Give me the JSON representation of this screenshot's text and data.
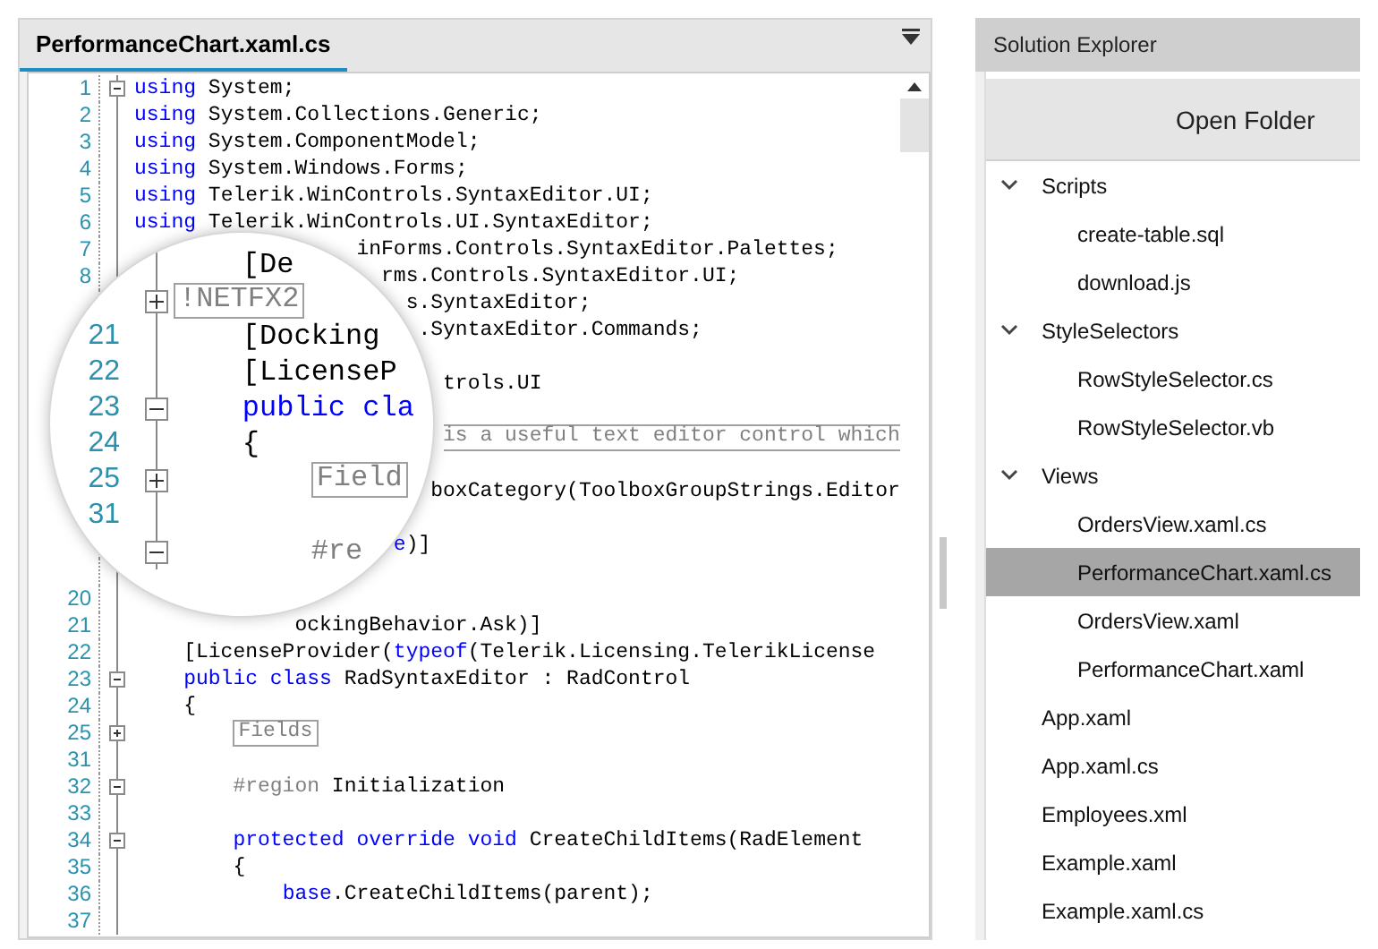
{
  "editor": {
    "tab": {
      "label": "PerformanceChart.xaml.cs",
      "selected": true
    },
    "rows": [
      {
        "number": "1",
        "expanded": true,
        "segments": [
          {
            "kind": "keyword",
            "text": "using"
          },
          {
            "kind": "plain",
            "text": " System;"
          }
        ]
      },
      {
        "number": "2",
        "segments": [
          {
            "kind": "keyword",
            "text": "using"
          },
          {
            "kind": "plain",
            "text": " System.Collections.Generic;"
          }
        ]
      },
      {
        "number": "3",
        "segments": [
          {
            "kind": "keyword",
            "text": "using"
          },
          {
            "kind": "plain",
            "text": " System.ComponentModel;"
          }
        ]
      },
      {
        "number": "4",
        "segments": [
          {
            "kind": "keyword",
            "text": "using"
          },
          {
            "kind": "plain",
            "text": " System.Windows.Forms;"
          }
        ]
      },
      {
        "number": "5",
        "segments": [
          {
            "kind": "keyword",
            "text": "using"
          },
          {
            "kind": "plain",
            "text": " Telerik.WinControls.SyntaxEditor.UI;"
          }
        ]
      },
      {
        "number": "6",
        "segments": [
          {
            "kind": "keyword",
            "text": "using"
          },
          {
            "kind": "plain",
            "text": " Telerik.WinControls.UI.SyntaxEditor;"
          }
        ]
      },
      {
        "number": "7",
        "segments": [
          {
            "kind": "plain",
            "text": "inForms.Controls.SyntaxEditor.Palettes;"
          }
        ]
      },
      {
        "number": "8",
        "segments": [
          {
            "kind": "plain",
            "text": "rms.Controls.SyntaxEditor.UI;"
          }
        ]
      },
      {
        "segments": [
          {
            "kind": "plain",
            "text": "s.SyntaxEditor;"
          }
        ]
      },
      {
        "segments": [
          {
            "kind": "plain",
            "text": ".SyntaxEditor.Commands;"
          }
        ]
      },
      {
        "segments": []
      },
      {
        "segments": [
          {
            "kind": "plain",
            "text": "trols.UI"
          }
        ]
      },
      {
        "segments": []
      },
      {
        "segments": [
          {
            "kind": "collapsed-comment",
            "text": "is a useful text editor control which"
          }
        ]
      },
      {
        "segments": []
      },
      {
        "segments": [
          {
            "kind": "plain",
            "text": "boxCategory(ToolboxGroupStrings.Editor"
          }
        ]
      },
      {
        "segments": []
      },
      {
        "segments": [
          {
            "kind": "keyword",
            "text": "e"
          },
          {
            "kind": "plain",
            "text": ")]"
          }
        ]
      },
      {
        "segments": []
      },
      {
        "number": "20",
        "segments": []
      },
      {
        "number": "21",
        "segments": [
          {
            "kind": "plain",
            "text": "ockingBehavior.Ask)]"
          }
        ]
      },
      {
        "number": "22",
        "segments": [
          {
            "kind": "plain",
            "text": "[LicenseProvider("
          },
          {
            "kind": "keyword",
            "text": "typeof"
          },
          {
            "kind": "plain",
            "text": "(Telerik.Licensing.TelerikLicense"
          }
        ]
      },
      {
        "number": "23",
        "expanded": true,
        "segments": [
          {
            "kind": "keyword",
            "text": "public class"
          },
          {
            "kind": "plain",
            "text": " RadSyntaxEditor : RadControl"
          }
        ]
      },
      {
        "number": "24",
        "segments": [
          {
            "kind": "plain",
            "text": "{"
          }
        ]
      },
      {
        "number": "25",
        "expanded": false,
        "segments": [
          {
            "kind": "collapsed",
            "text": "Fields"
          }
        ]
      },
      {
        "number": "31",
        "segments": []
      },
      {
        "number": "32",
        "expanded": true,
        "segments": [
          {
            "kind": "preproc",
            "text": "#region"
          },
          {
            "kind": "plain",
            "text": " Initialization"
          }
        ]
      },
      {
        "number": "33",
        "segments": []
      },
      {
        "number": "34",
        "expanded": true,
        "segments": [
          {
            "kind": "keyword",
            "text": "protected override void"
          },
          {
            "kind": "plain",
            "text": " CreateChildItems(RadElement"
          }
        ]
      },
      {
        "number": "35",
        "segments": [
          {
            "kind": "plain",
            "text": "{"
          }
        ]
      },
      {
        "number": "36",
        "segments": [
          {
            "kind": "keyword",
            "text": "base"
          },
          {
            "kind": "plain",
            "text": ".CreateChildItems(parent);"
          }
        ]
      },
      {
        "number": "37",
        "segments": []
      }
    ],
    "magnifier": {
      "rows": [
        {
          "segments": [
            {
              "kind": "plain",
              "text": "[De"
            }
          ]
        },
        {
          "expanded": false,
          "segments": [
            {
              "kind": "collapsed",
              "text": "!NETFX2"
            }
          ]
        },
        {
          "number": "21",
          "segments": [
            {
              "kind": "plain",
              "text": "[Docking"
            }
          ]
        },
        {
          "number": "22",
          "segments": [
            {
              "kind": "plain",
              "text": "[LicenseP"
            }
          ]
        },
        {
          "number": "23",
          "expanded": true,
          "segments": [
            {
              "kind": "keyword",
              "text": "public cla"
            }
          ]
        },
        {
          "number": "24",
          "segments": [
            {
              "kind": "plain",
              "text": "{"
            }
          ]
        },
        {
          "number": "25",
          "expanded": false,
          "segments": [
            {
              "kind": "collapsed",
              "text": "Field"
            }
          ]
        },
        {
          "number": "31",
          "segments": []
        },
        {
          "expanded": true,
          "segments": [
            {
              "kind": "preproc",
              "text": "#re"
            }
          ]
        }
      ]
    }
  },
  "solution_explorer": {
    "title": "Solution Explorer",
    "open_button": "Open Folder",
    "items": [
      {
        "label": "Scripts",
        "expanded": true,
        "selected": false,
        "children": [
          {
            "label": "create-table.sql",
            "selected": false
          },
          {
            "label": "download.js",
            "selected": false
          }
        ]
      },
      {
        "label": "StyleSelectors",
        "expanded": true,
        "selected": false,
        "children": [
          {
            "label": "RowStyleSelector.cs",
            "selected": false
          },
          {
            "label": "RowStyleSelector.vb",
            "selected": false
          }
        ]
      },
      {
        "label": "Views",
        "expanded": true,
        "selected": false,
        "children": [
          {
            "label": "OrdersView.xaml.cs",
            "selected": false
          },
          {
            "label": "PerformanceChart.xaml.cs",
            "selected": true
          },
          {
            "label": "OrdersView.xaml",
            "selected": false
          },
          {
            "label": "PerformanceChart.xaml",
            "selected": false
          }
        ]
      },
      {
        "label": "App.xaml",
        "selected": false
      },
      {
        "label": "App.xaml.cs",
        "selected": false
      },
      {
        "label": "Employees.xml",
        "selected": false
      },
      {
        "label": "Example.xaml",
        "selected": false
      },
      {
        "label": "Example.xaml.cs",
        "selected": false
      }
    ]
  }
}
